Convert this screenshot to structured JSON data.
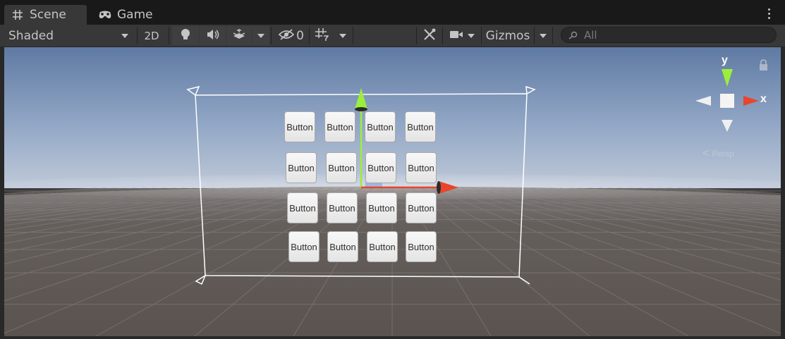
{
  "tabs": [
    {
      "label": "Scene",
      "icon": "hash-icon",
      "active": true
    },
    {
      "label": "Game",
      "icon": "gamepad-icon",
      "active": false
    }
  ],
  "toolbar": {
    "draw_mode": "Shaded",
    "mode_2d": "2D",
    "hidden_count": "0",
    "gizmos_label": "Gizmos"
  },
  "search": {
    "placeholder": "All"
  },
  "viewport": {
    "buttons": [
      [
        "Button",
        "Button",
        "Button",
        "Button"
      ],
      [
        "Button",
        "Button",
        "Button",
        "Button"
      ],
      [
        "Button",
        "Button",
        "Button",
        "Button"
      ],
      [
        "Button",
        "Button",
        "Button",
        "Button"
      ]
    ],
    "axis_labels": {
      "y": "y",
      "x": "x"
    },
    "projection": "Persp"
  },
  "colors": {
    "x_axis": "#e8452c",
    "y_axis": "#9bef3a",
    "sky_top": "#5f7aa3",
    "ground": "#5d5754"
  }
}
